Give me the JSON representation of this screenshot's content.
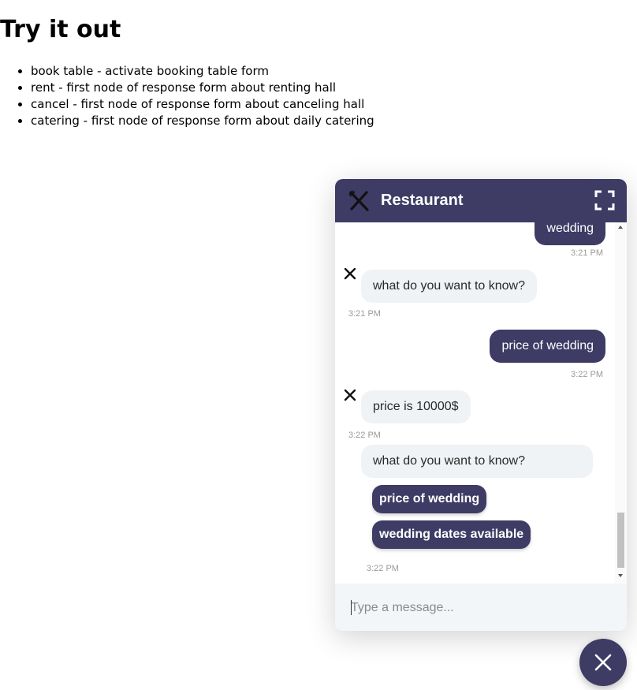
{
  "page": {
    "title": "Try it out",
    "hints": [
      "book table - activate booking table form",
      "rent - first node of response form about renting hall",
      "cancel - first node of response form about canceling hall",
      "catering - first node of response form about daily catering"
    ]
  },
  "widget": {
    "title": "Restaurant",
    "logo_icon": "fork-knife-icon",
    "fullscreen_icon": "fullscreen-icon",
    "accent_color": "#3e3b65",
    "messages": [
      {
        "sender": "user",
        "text": "wedding",
        "time": "3:21 PM"
      },
      {
        "sender": "bot",
        "text": "what do you want to know?",
        "time": "3:21 PM"
      },
      {
        "sender": "user",
        "text": "price of wedding",
        "time": "3:22 PM"
      },
      {
        "sender": "bot",
        "text": "price is 10000$",
        "time": "3:22 PM"
      },
      {
        "sender": "bot",
        "text": "what do you want to know?",
        "time": "3:22 PM"
      }
    ],
    "quick_replies": [
      "price of wedding",
      "wedding dates available"
    ],
    "composer": {
      "placeholder": "Type a message..."
    },
    "launcher_icon": "close-icon"
  }
}
